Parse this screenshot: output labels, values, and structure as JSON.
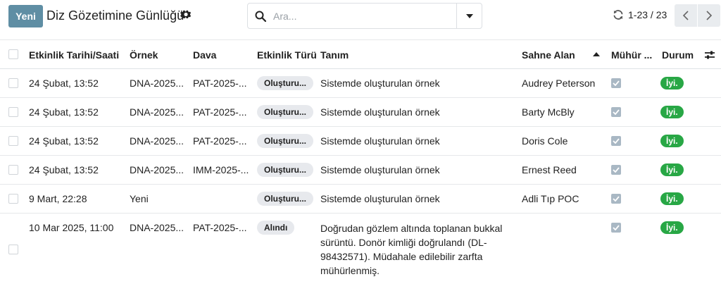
{
  "control_panel": {
    "new_label": "Yeni",
    "title": "Diz Gözetimine Günlüğü",
    "search_placeholder": "Ara...",
    "pager_value": "1-23 / 23"
  },
  "table": {
    "columns": {
      "date": "Etkinlik Tarihi/Saati",
      "sample": "Örnek",
      "case": "Dava",
      "event_type": "Etkinlik Türü",
      "description": "Tanım",
      "scene": "Sahne Alan",
      "seal": "Mühür ...",
      "status": "Durum"
    },
    "sorted_column": "scene",
    "rows": [
      {
        "date": "24 Şubat, 13:52",
        "sample": "DNA-2025...",
        "case": "PAT-2025-...",
        "event_type": "Oluşturu...",
        "description": "Sistemde oluşturulan örnek",
        "scene": "Audrey Peterson",
        "sealed": true,
        "status": "İyi."
      },
      {
        "date": "24 Şubat, 13:52",
        "sample": "DNA-2025...",
        "case": "PAT-2025-...",
        "event_type": "Oluşturu...",
        "description": "Sistemde oluşturulan örnek",
        "scene": "Barty McBly",
        "sealed": true,
        "status": "İyi."
      },
      {
        "date": "24 Şubat, 13:52",
        "sample": "DNA-2025...",
        "case": "PAT-2025-...",
        "event_type": "Oluşturu...",
        "description": "Sistemde oluşturulan örnek",
        "scene": "Doris Cole",
        "sealed": true,
        "status": "İyi."
      },
      {
        "date": "24 Şubat, 13:52",
        "sample": "DNA-2025...",
        "case": "IMM-2025-...",
        "event_type": "Oluşturu...",
        "description": "Sistemde oluşturulan örnek",
        "scene": "Ernest Reed",
        "sealed": true,
        "status": "İyi."
      },
      {
        "date": "9 Mart, 22:28",
        "sample": "Yeni",
        "case": "",
        "event_type": "Oluşturu...",
        "description": "Sistemde oluşturulan örnek",
        "scene": "Adli Tıp POC",
        "sealed": true,
        "status": "İyi."
      },
      {
        "date": "10 Mar 2025, 11:00",
        "sample": "DNA-2025...",
        "case": "PAT-2025-...",
        "event_type": "Alındı",
        "description": "Doğrudan gözlem altında toplanan bukkal sürüntü. Donör kimliği doğrulandı (DL-98432571). Müdahale edilebilir zarfta mühürlenmiş.",
        "scene": "",
        "sealed": true,
        "status": "İyi."
      }
    ]
  },
  "colors": {
    "primary": "#5f8ea4",
    "status_ok": "#28a745",
    "tag_bg": "#e7e9ed",
    "pager_btn_bg": "#e9ecef"
  }
}
